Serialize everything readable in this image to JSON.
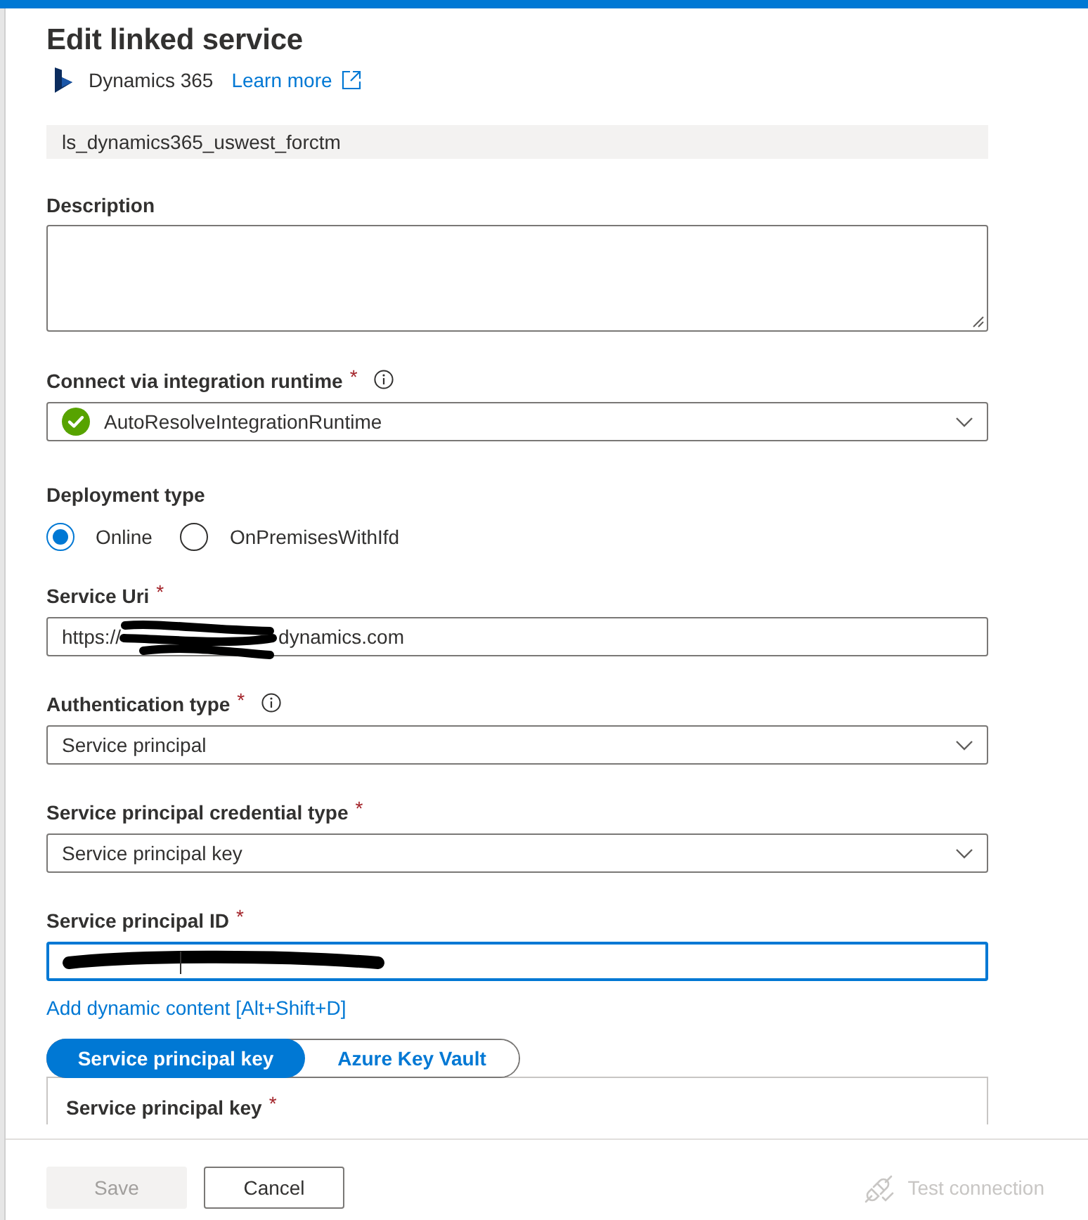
{
  "title": "Edit linked service",
  "connector": {
    "name": "Dynamics 365",
    "link": "Learn more"
  },
  "fields": [
    {
      "kind": "readonly",
      "value": "ls_dynamics365_uswest_forctm"
    },
    {
      "kind": "textarea",
      "label": "Description"
    },
    {
      "kind": "dropdown",
      "label": "Connect via integration runtime",
      "required_mark": "*",
      "info": true,
      "healthy": true,
      "value": "AutoResolveIntegrationRuntime"
    },
    {
      "kind": "radio",
      "label": "Deployment type",
      "options": [
        {
          "label": "Online",
          "selected": true
        },
        {
          "label": "OnPremisesWithIfd",
          "selected": false
        }
      ]
    },
    {
      "kind": "text",
      "label": "Service Uri",
      "required_mark": "*",
      "value_parts": [
        "https://",
        "dynamics.com"
      ],
      "redacted": true,
      "focused": false
    },
    {
      "kind": "dropdown",
      "label": "Authentication type",
      "required_mark": "*",
      "info": true,
      "value": "Service principal"
    },
    {
      "kind": "dropdown",
      "label": "Service principal credential type",
      "required_mark": "*",
      "value": "Service principal key"
    },
    {
      "kind": "text",
      "label": "Service principal ID",
      "required_mark": "*",
      "redacted": true,
      "focused": true
    }
  ],
  "dynamic_content_link": "Add dynamic content [Alt+Shift+D]",
  "source_toggle": [
    {
      "label": "Service principal key",
      "selected": true
    },
    {
      "label": "Azure Key Vault",
      "selected": false
    }
  ],
  "key_panel": {
    "label": "Service principal key",
    "required_mark": "*"
  },
  "footer": {
    "buttons": [
      {
        "label": "Save",
        "disabled": true
      },
      {
        "label": "Cancel",
        "disabled": false
      }
    ],
    "test_connection": {
      "label": "Test connection",
      "disabled": true
    }
  }
}
